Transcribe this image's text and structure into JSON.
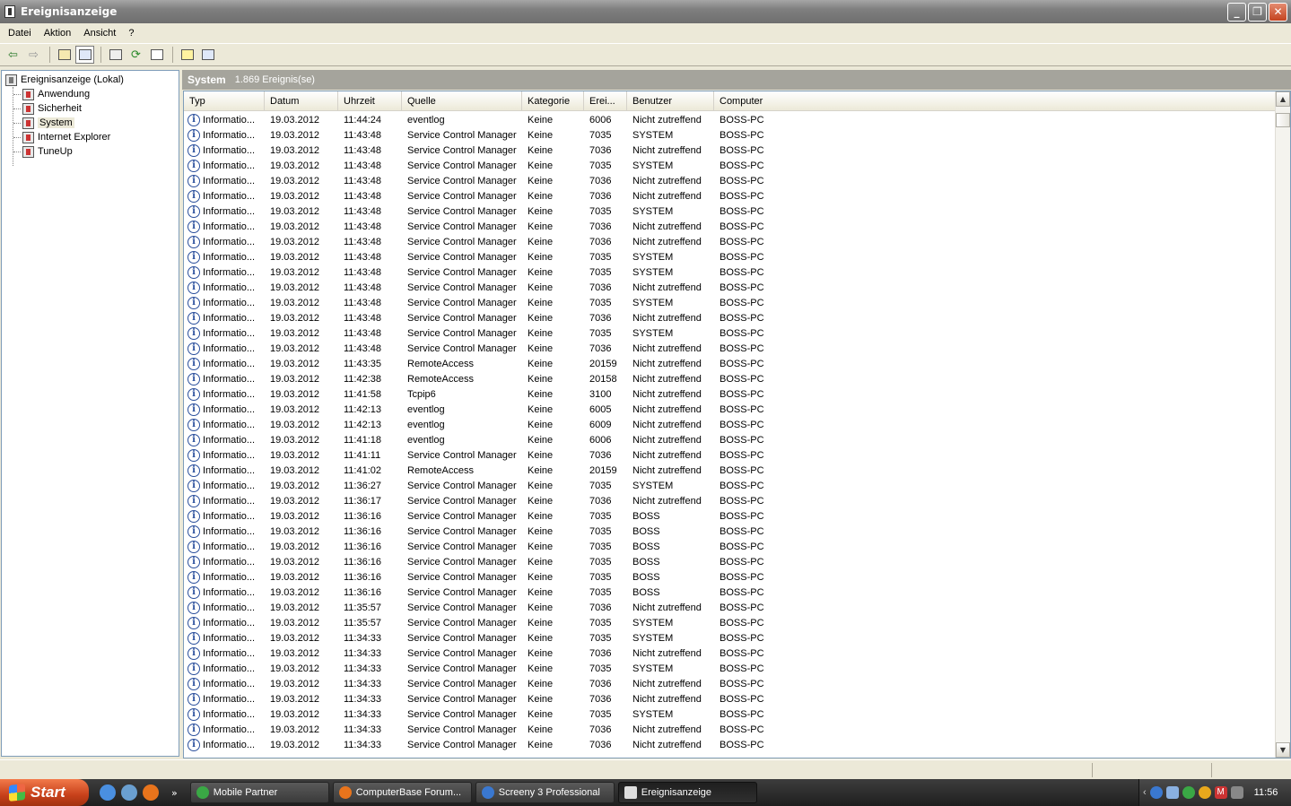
{
  "window": {
    "title": "Ereignisanzeige"
  },
  "menu": [
    "Datei",
    "Aktion",
    "Ansicht",
    "?"
  ],
  "toolbar": {
    "icons": [
      "back-icon",
      "forward-icon",
      "up-folder-icon",
      "show-hide-tree-icon",
      "properties-icon",
      "refresh-icon",
      "export-list-icon",
      "help-icon",
      "console-icon"
    ]
  },
  "tree": {
    "root": "Ereignisanzeige (Lokal)",
    "items": [
      "Anwendung",
      "Sicherheit",
      "System",
      "Internet Explorer",
      "TuneUp"
    ],
    "selected": "System"
  },
  "pane": {
    "title": "System",
    "count": "1.869 Ereignis(se)"
  },
  "columns": [
    "Typ",
    "Datum",
    "Uhrzeit",
    "Quelle",
    "Kategorie",
    "Erei...",
    "Benutzer",
    "Computer"
  ],
  "rows": [
    [
      "Informatio...",
      "19.03.2012",
      "11:44:24",
      "eventlog",
      "Keine",
      "6006",
      "Nicht zutreffend",
      "BOSS-PC"
    ],
    [
      "Informatio...",
      "19.03.2012",
      "11:43:48",
      "Service Control Manager",
      "Keine",
      "7035",
      "SYSTEM",
      "BOSS-PC"
    ],
    [
      "Informatio...",
      "19.03.2012",
      "11:43:48",
      "Service Control Manager",
      "Keine",
      "7036",
      "Nicht zutreffend",
      "BOSS-PC"
    ],
    [
      "Informatio...",
      "19.03.2012",
      "11:43:48",
      "Service Control Manager",
      "Keine",
      "7035",
      "SYSTEM",
      "BOSS-PC"
    ],
    [
      "Informatio...",
      "19.03.2012",
      "11:43:48",
      "Service Control Manager",
      "Keine",
      "7036",
      "Nicht zutreffend",
      "BOSS-PC"
    ],
    [
      "Informatio...",
      "19.03.2012",
      "11:43:48",
      "Service Control Manager",
      "Keine",
      "7036",
      "Nicht zutreffend",
      "BOSS-PC"
    ],
    [
      "Informatio...",
      "19.03.2012",
      "11:43:48",
      "Service Control Manager",
      "Keine",
      "7035",
      "SYSTEM",
      "BOSS-PC"
    ],
    [
      "Informatio...",
      "19.03.2012",
      "11:43:48",
      "Service Control Manager",
      "Keine",
      "7036",
      "Nicht zutreffend",
      "BOSS-PC"
    ],
    [
      "Informatio...",
      "19.03.2012",
      "11:43:48",
      "Service Control Manager",
      "Keine",
      "7036",
      "Nicht zutreffend",
      "BOSS-PC"
    ],
    [
      "Informatio...",
      "19.03.2012",
      "11:43:48",
      "Service Control Manager",
      "Keine",
      "7035",
      "SYSTEM",
      "BOSS-PC"
    ],
    [
      "Informatio...",
      "19.03.2012",
      "11:43:48",
      "Service Control Manager",
      "Keine",
      "7035",
      "SYSTEM",
      "BOSS-PC"
    ],
    [
      "Informatio...",
      "19.03.2012",
      "11:43:48",
      "Service Control Manager",
      "Keine",
      "7036",
      "Nicht zutreffend",
      "BOSS-PC"
    ],
    [
      "Informatio...",
      "19.03.2012",
      "11:43:48",
      "Service Control Manager",
      "Keine",
      "7035",
      "SYSTEM",
      "BOSS-PC"
    ],
    [
      "Informatio...",
      "19.03.2012",
      "11:43:48",
      "Service Control Manager",
      "Keine",
      "7036",
      "Nicht zutreffend",
      "BOSS-PC"
    ],
    [
      "Informatio...",
      "19.03.2012",
      "11:43:48",
      "Service Control Manager",
      "Keine",
      "7035",
      "SYSTEM",
      "BOSS-PC"
    ],
    [
      "Informatio...",
      "19.03.2012",
      "11:43:48",
      "Service Control Manager",
      "Keine",
      "7036",
      "Nicht zutreffend",
      "BOSS-PC"
    ],
    [
      "Informatio...",
      "19.03.2012",
      "11:43:35",
      "RemoteAccess",
      "Keine",
      "20159",
      "Nicht zutreffend",
      "BOSS-PC"
    ],
    [
      "Informatio...",
      "19.03.2012",
      "11:42:38",
      "RemoteAccess",
      "Keine",
      "20158",
      "Nicht zutreffend",
      "BOSS-PC"
    ],
    [
      "Informatio...",
      "19.03.2012",
      "11:41:58",
      "Tcpip6",
      "Keine",
      "3100",
      "Nicht zutreffend",
      "BOSS-PC"
    ],
    [
      "Informatio...",
      "19.03.2012",
      "11:42:13",
      "eventlog",
      "Keine",
      "6005",
      "Nicht zutreffend",
      "BOSS-PC"
    ],
    [
      "Informatio...",
      "19.03.2012",
      "11:42:13",
      "eventlog",
      "Keine",
      "6009",
      "Nicht zutreffend",
      "BOSS-PC"
    ],
    [
      "Informatio...",
      "19.03.2012",
      "11:41:18",
      "eventlog",
      "Keine",
      "6006",
      "Nicht zutreffend",
      "BOSS-PC"
    ],
    [
      "Informatio...",
      "19.03.2012",
      "11:41:11",
      "Service Control Manager",
      "Keine",
      "7036",
      "Nicht zutreffend",
      "BOSS-PC"
    ],
    [
      "Informatio...",
      "19.03.2012",
      "11:41:02",
      "RemoteAccess",
      "Keine",
      "20159",
      "Nicht zutreffend",
      "BOSS-PC"
    ],
    [
      "Informatio...",
      "19.03.2012",
      "11:36:27",
      "Service Control Manager",
      "Keine",
      "7035",
      "SYSTEM",
      "BOSS-PC"
    ],
    [
      "Informatio...",
      "19.03.2012",
      "11:36:17",
      "Service Control Manager",
      "Keine",
      "7036",
      "Nicht zutreffend",
      "BOSS-PC"
    ],
    [
      "Informatio...",
      "19.03.2012",
      "11:36:16",
      "Service Control Manager",
      "Keine",
      "7035",
      "BOSS",
      "BOSS-PC"
    ],
    [
      "Informatio...",
      "19.03.2012",
      "11:36:16",
      "Service Control Manager",
      "Keine",
      "7035",
      "BOSS",
      "BOSS-PC"
    ],
    [
      "Informatio...",
      "19.03.2012",
      "11:36:16",
      "Service Control Manager",
      "Keine",
      "7035",
      "BOSS",
      "BOSS-PC"
    ],
    [
      "Informatio...",
      "19.03.2012",
      "11:36:16",
      "Service Control Manager",
      "Keine",
      "7035",
      "BOSS",
      "BOSS-PC"
    ],
    [
      "Informatio...",
      "19.03.2012",
      "11:36:16",
      "Service Control Manager",
      "Keine",
      "7035",
      "BOSS",
      "BOSS-PC"
    ],
    [
      "Informatio...",
      "19.03.2012",
      "11:36:16",
      "Service Control Manager",
      "Keine",
      "7035",
      "BOSS",
      "BOSS-PC"
    ],
    [
      "Informatio...",
      "19.03.2012",
      "11:35:57",
      "Service Control Manager",
      "Keine",
      "7036",
      "Nicht zutreffend",
      "BOSS-PC"
    ],
    [
      "Informatio...",
      "19.03.2012",
      "11:35:57",
      "Service Control Manager",
      "Keine",
      "7035",
      "SYSTEM",
      "BOSS-PC"
    ],
    [
      "Informatio...",
      "19.03.2012",
      "11:34:33",
      "Service Control Manager",
      "Keine",
      "7035",
      "SYSTEM",
      "BOSS-PC"
    ],
    [
      "Informatio...",
      "19.03.2012",
      "11:34:33",
      "Service Control Manager",
      "Keine",
      "7036",
      "Nicht zutreffend",
      "BOSS-PC"
    ],
    [
      "Informatio...",
      "19.03.2012",
      "11:34:33",
      "Service Control Manager",
      "Keine",
      "7035",
      "SYSTEM",
      "BOSS-PC"
    ],
    [
      "Informatio...",
      "19.03.2012",
      "11:34:33",
      "Service Control Manager",
      "Keine",
      "7036",
      "Nicht zutreffend",
      "BOSS-PC"
    ],
    [
      "Informatio...",
      "19.03.2012",
      "11:34:33",
      "Service Control Manager",
      "Keine",
      "7036",
      "Nicht zutreffend",
      "BOSS-PC"
    ],
    [
      "Informatio...",
      "19.03.2012",
      "11:34:33",
      "Service Control Manager",
      "Keine",
      "7035",
      "SYSTEM",
      "BOSS-PC"
    ],
    [
      "Informatio...",
      "19.03.2012",
      "11:34:33",
      "Service Control Manager",
      "Keine",
      "7036",
      "Nicht zutreffend",
      "BOSS-PC"
    ],
    [
      "Informatio...",
      "19.03.2012",
      "11:34:33",
      "Service Control Manager",
      "Keine",
      "7036",
      "Nicht zutreffend",
      "BOSS-PC"
    ]
  ],
  "taskbar": {
    "start": "Start",
    "buttons": [
      {
        "label": "Mobile Partner",
        "color": "#3aa845"
      },
      {
        "label": "ComputerBase Forum...",
        "color": "#e8741c"
      },
      {
        "label": "Screeny 3 Professional",
        "color": "#3a78d0"
      },
      {
        "label": "Ereignisanzeige",
        "color": "#dddddd"
      }
    ],
    "active": "Ereignisanzeige",
    "clock": "11:56"
  }
}
